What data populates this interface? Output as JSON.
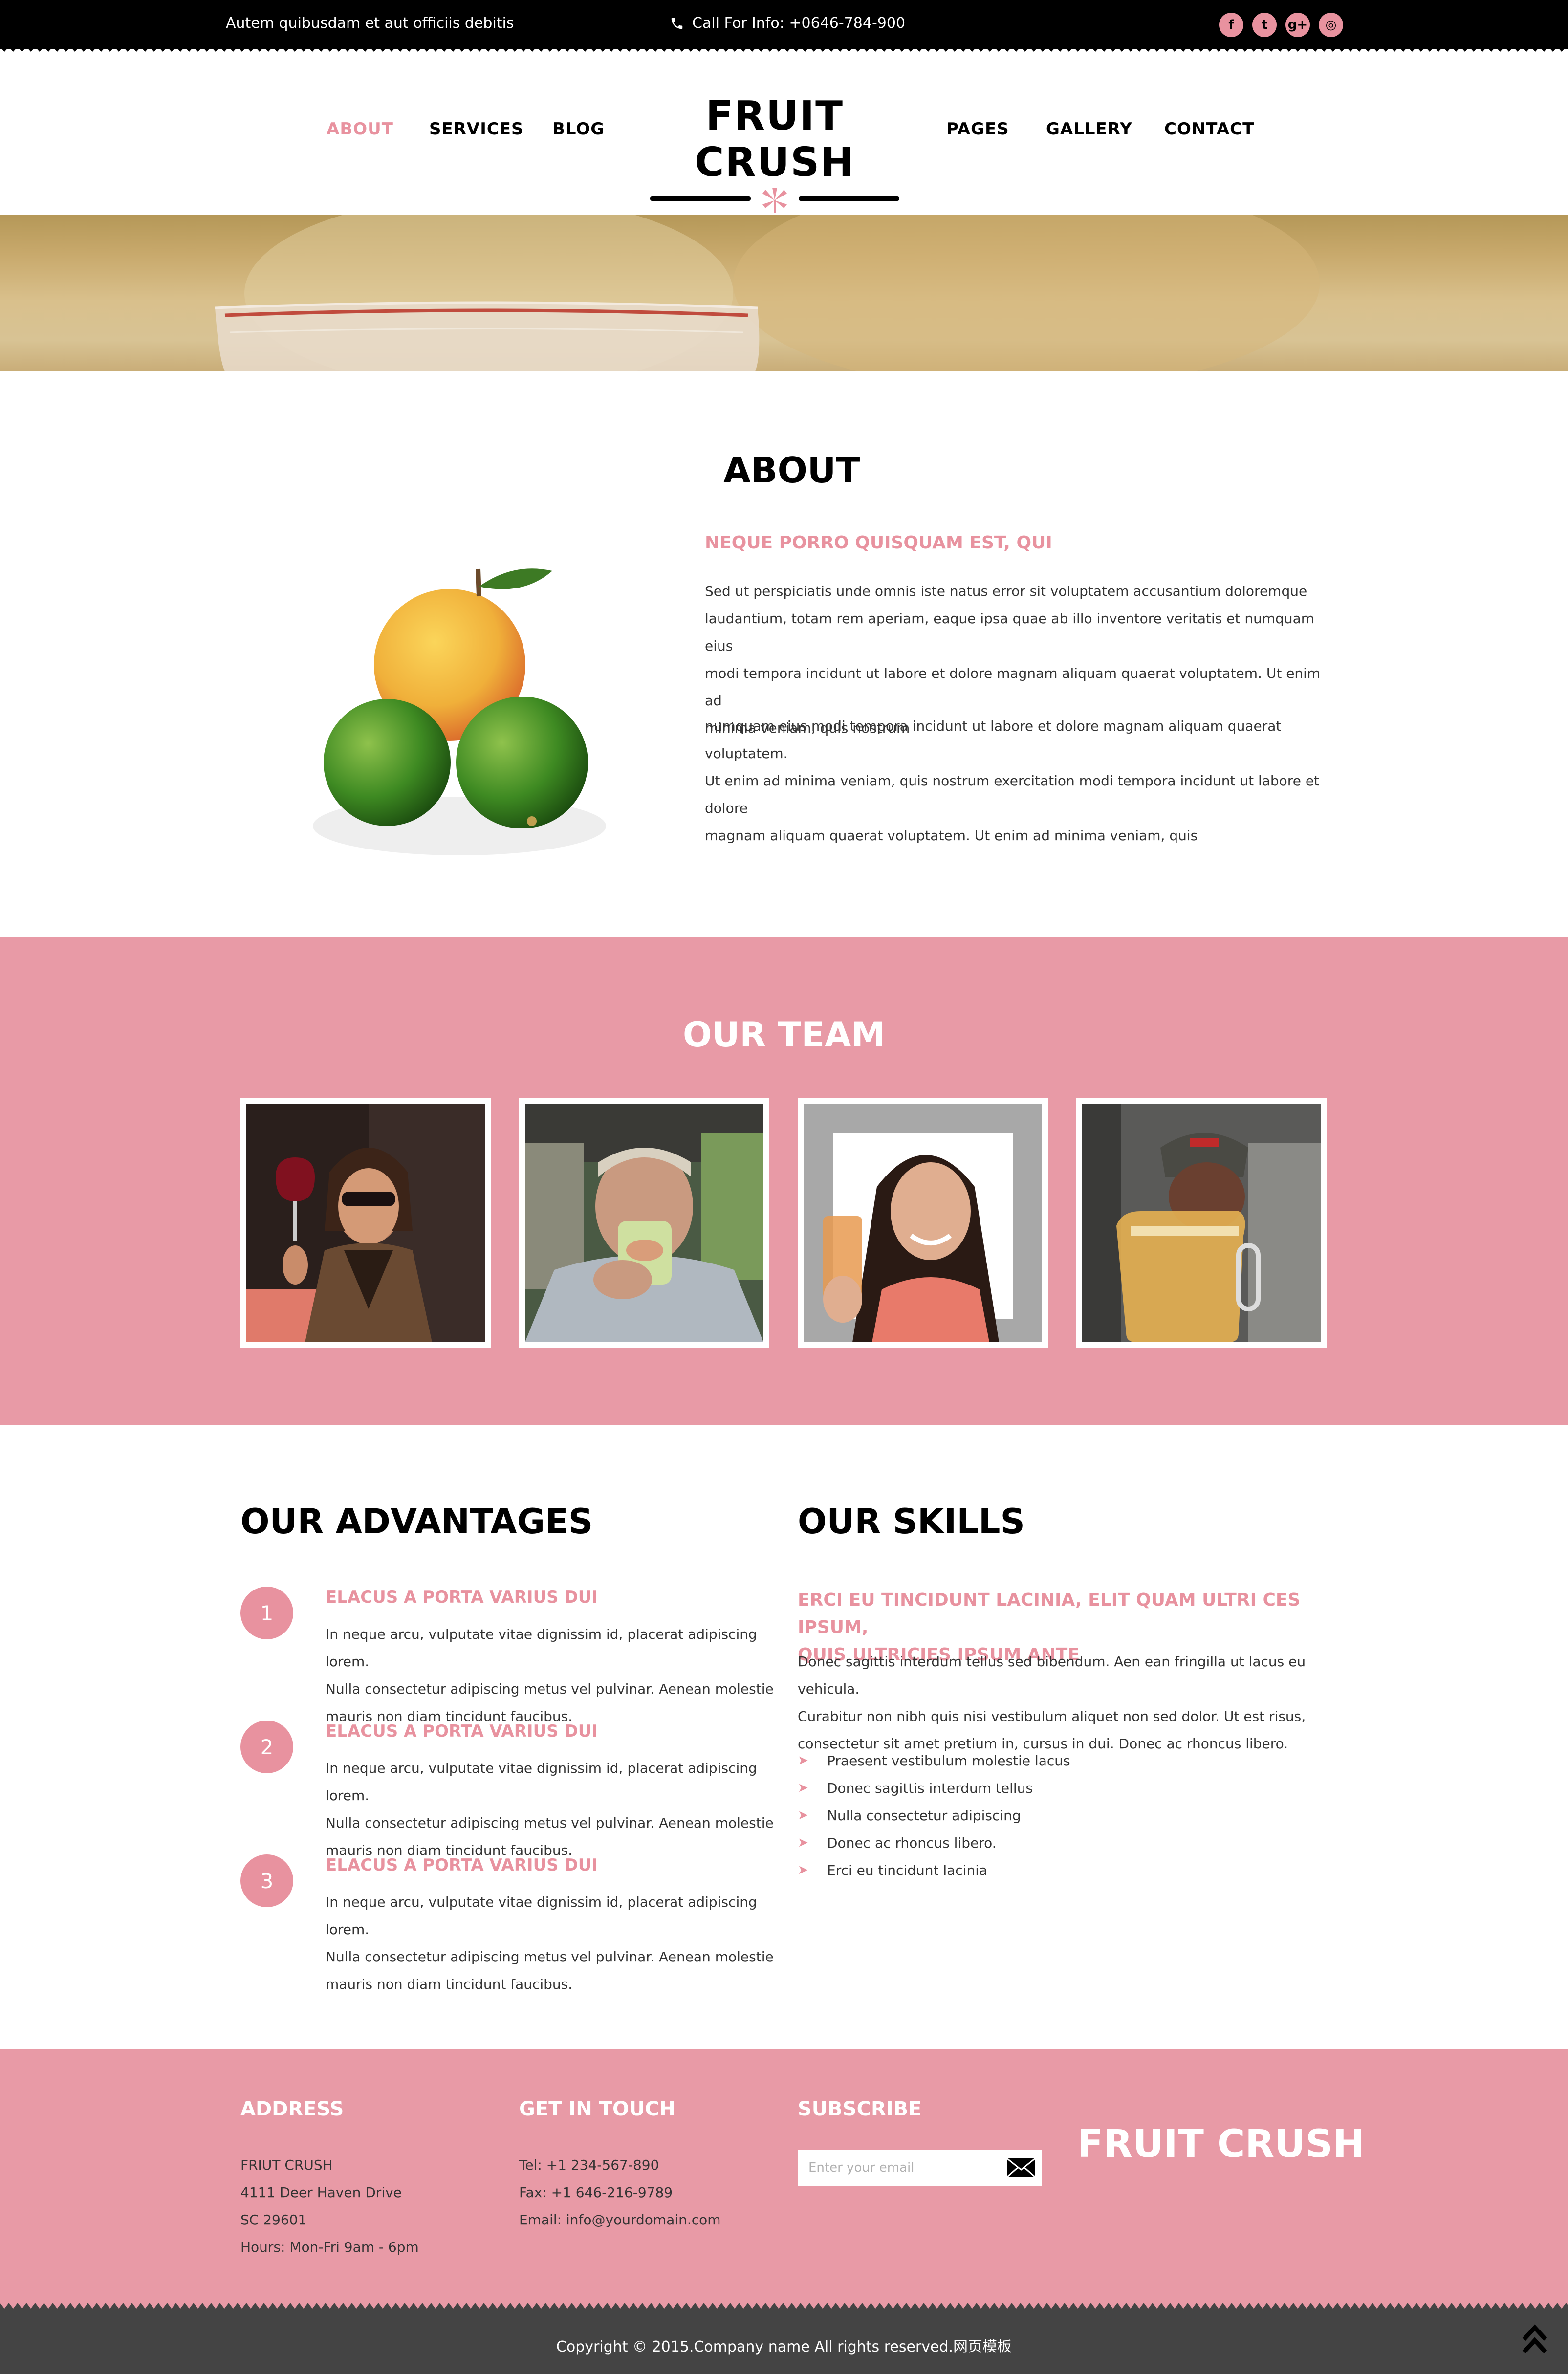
{
  "topbar": {
    "tagline": "Autem quibusdam et aut officiis debitis",
    "phone": "Call For Info: +0646-784-900",
    "social": [
      {
        "icon": "facebook-icon",
        "glyph": "f"
      },
      {
        "icon": "twitter-icon",
        "glyph": "t"
      },
      {
        "icon": "google-plus-icon",
        "glyph": "g+"
      },
      {
        "icon": "dribbble-icon",
        "glyph": "◎"
      }
    ]
  },
  "nav": {
    "left": [
      "ABOUT",
      "SERVICES",
      "BLOG"
    ],
    "right": [
      "PAGES",
      "GALLERY",
      "CONTACT"
    ],
    "active": "ABOUT",
    "logo": "FRUIT CRUSH"
  },
  "about": {
    "title": "ABOUT",
    "subtitle": "NEQUE PORRO QUISQUAM EST, QUI",
    "p1_lines": [
      "Sed ut perspiciatis unde omnis iste natus error sit voluptatem accusantium doloremque",
      "laudantium, totam rem aperiam, eaque ipsa quae ab illo inventore veritatis et numquam eius",
      "modi tempora incidunt ut labore et dolore magnam aliquam quaerat voluptatem. Ut enim ad",
      "minima veniam, quis nostrum"
    ],
    "p2_lines": [
      "numquam eius modi tempora incidunt ut labore et dolore magnam aliquam quaerat voluptatem.",
      "Ut enim ad minima veniam, quis nostrum exercitation modi tempora incidunt ut labore et dolore",
      "magnam aliquam quaerat voluptatem. Ut enim ad minima veniam, quis"
    ]
  },
  "team": {
    "title": "OUR TEAM",
    "members": [
      {
        "name": "team-member-1"
      },
      {
        "name": "team-member-2"
      },
      {
        "name": "team-member-3"
      },
      {
        "name": "team-member-4"
      }
    ]
  },
  "advantages": {
    "title": "OUR ADVANTAGES",
    "items": [
      {
        "num": "1",
        "title": "ELACUS A PORTA VARIUS DUI",
        "lines": [
          "In neque arcu, vulputate vitae dignissim id, placerat adipiscing lorem.",
          "Nulla consectetur adipiscing metus vel pulvinar. Aenean molestie",
          "mauris non diam tincidunt faucibus."
        ]
      },
      {
        "num": "2",
        "title": "ELACUS A PORTA VARIUS DUI",
        "lines": [
          "In neque arcu, vulputate vitae dignissim id, placerat adipiscing lorem.",
          "Nulla consectetur adipiscing metus vel pulvinar. Aenean molestie",
          "mauris non diam tincidunt faucibus."
        ]
      },
      {
        "num": "3",
        "title": "ELACUS A PORTA VARIUS DUI",
        "lines": [
          "In neque arcu, vulputate vitae dignissim id, placerat adipiscing lorem.",
          "Nulla consectetur adipiscing metus vel pulvinar. Aenean molestie",
          "mauris non diam tincidunt faucibus."
        ]
      }
    ]
  },
  "skills": {
    "title": "OUR SKILLS",
    "subtitle_lines": [
      "ERCI EU TINCIDUNT LACINIA, ELIT QUAM ULTRI CES IPSUM,",
      "QUIS ULTRICIES IPSUM ANTE"
    ],
    "p_lines": [
      "Donec sagittis interdum tellus sed bibendum. Aen ean fringilla ut lacus eu vehicula.",
      "Curabitur non nibh quis nisi vestibulum aliquet non sed dolor. Ut est risus,",
      "consectetur sit amet pretium in, cursus in dui. Donec ac rhoncus libero."
    ],
    "list": [
      "Praesent vestibulum molestie lacus",
      "Donec sagittis interdum tellus",
      "Nulla consectetur adipiscing",
      "Donec ac rhoncus libero.",
      "Erci eu tincidunt lacinia"
    ]
  },
  "footer": {
    "address": {
      "title": "ADDRESS",
      "lines": [
        "FRIUT CRUSH",
        "4111 Deer Haven Drive",
        "SC 29601",
        "Hours: Mon-Fri 9am - 6pm"
      ]
    },
    "contact": {
      "title": "GET IN TOUCH",
      "lines": [
        "Tel: +1 234-567-890",
        "Fax: +1 646-216-9789",
        "Email: info@yourdomain.com"
      ]
    },
    "subscribe": {
      "title": "SUBSCRIBE",
      "placeholder": "Enter your email"
    },
    "logo": "FRUIT CRUSH",
    "copyright": "Copyright © 2015.Company name All rights reserved.网页模板"
  },
  "colors": {
    "accent": "#e8929f",
    "dark": "#000000",
    "footer_bottom": "#444444"
  }
}
